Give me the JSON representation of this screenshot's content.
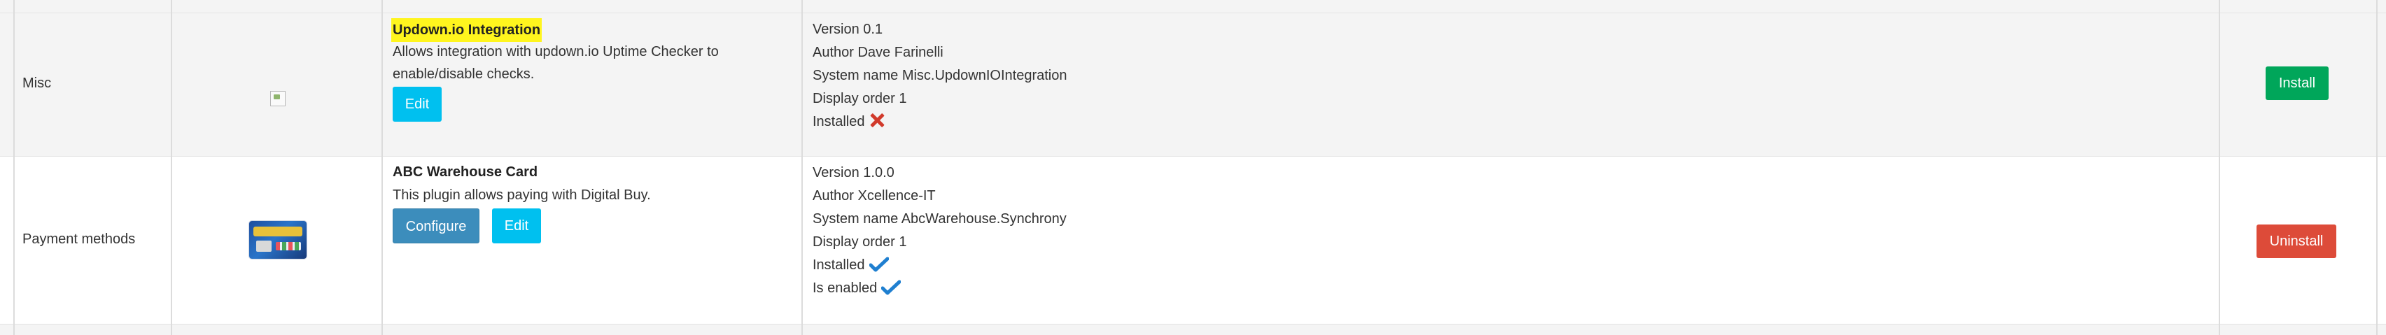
{
  "plugins": [
    {
      "group": "Misc",
      "logo": "broken-image-icon",
      "name": "Updown.io Integration",
      "description": "Allows integration with updown.io Uptime Checker to enable/disable checks.",
      "buttons": {
        "edit": "Edit"
      },
      "info": {
        "version": "Version 0.1",
        "author": "Author Dave Farinelli",
        "system_name": "System name Misc.UpdownIOIntegration",
        "display_order": "Display order 1",
        "installed_label": "Installed",
        "installed_icon": "x-icon"
      },
      "action": "Install"
    },
    {
      "group": "Payment methods",
      "logo": "card-logo",
      "name": "ABC Warehouse Card",
      "description": "This plugin allows paying with Digital Buy.",
      "buttons": {
        "configure": "Configure",
        "edit": "Edit"
      },
      "info": {
        "version": "Version 1.0.0",
        "author": "Author Xcellence-IT",
        "system_name": "System name AbcWarehouse.Synchrony",
        "display_order": "Display order 1",
        "installed_label": "Installed",
        "installed_icon": "check-icon",
        "enabled_label": "Is enabled",
        "enabled_icon": "check-icon"
      },
      "action": "Uninstall"
    }
  ],
  "colors": {
    "highlight": "#fff51e",
    "edit": "#00c0ef",
    "configure": "#3c8dbc",
    "install": "#00a65a",
    "uninstall": "#dd4b39",
    "check": "#1f7fd0",
    "x": "#d13a2b"
  }
}
